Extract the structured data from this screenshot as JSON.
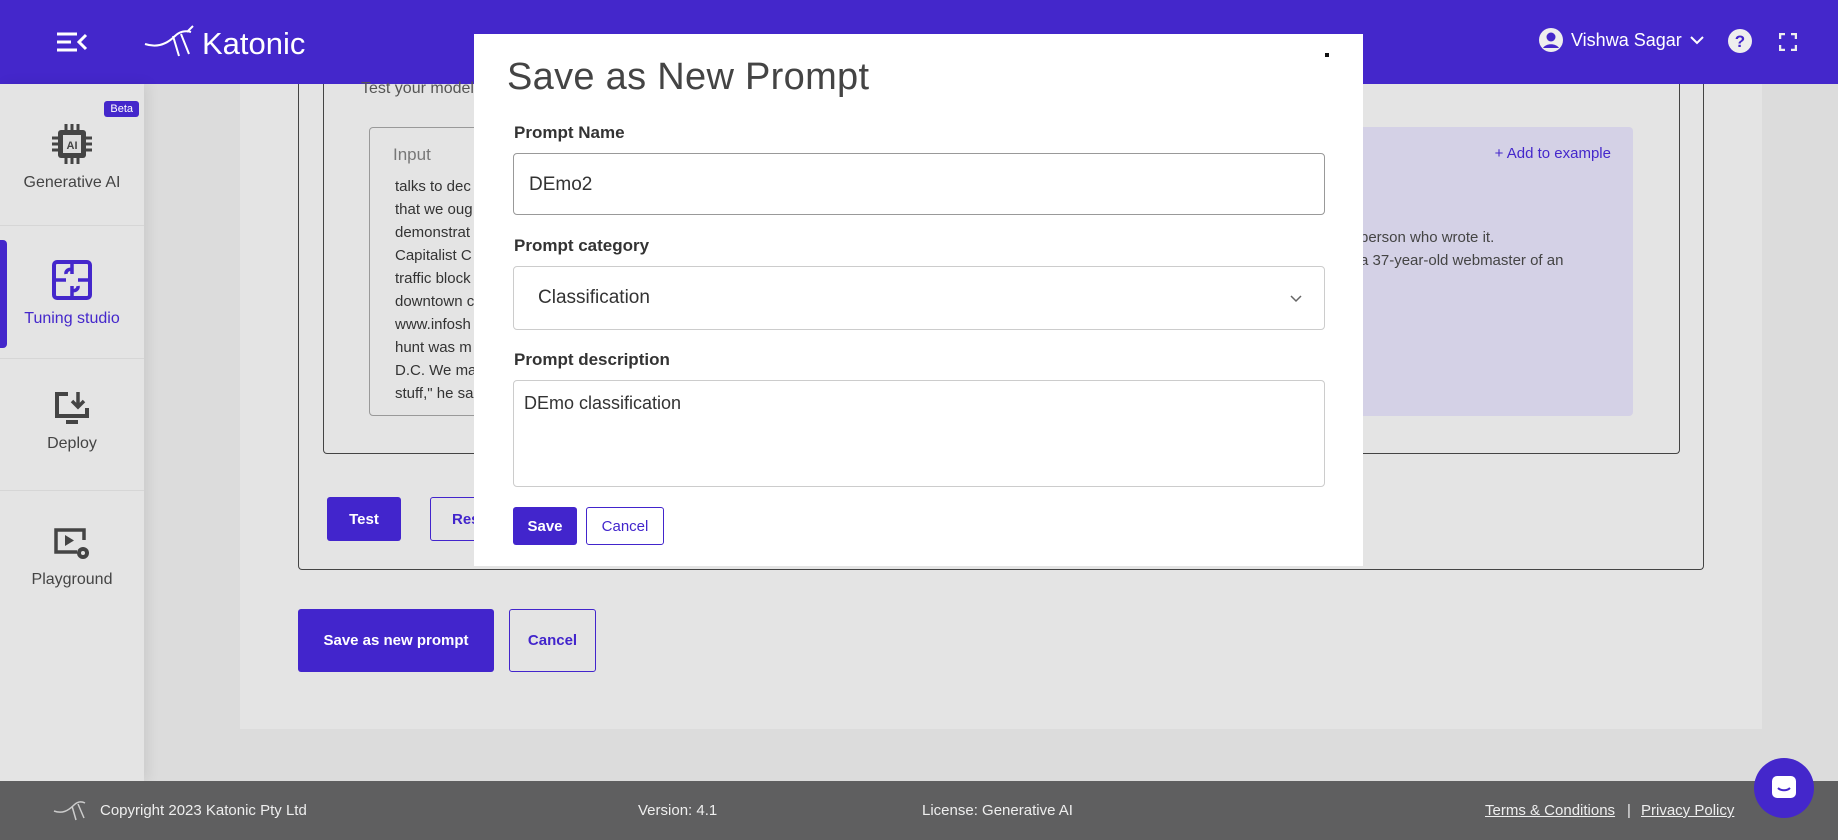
{
  "header": {
    "brand": "Katonic",
    "user_name": "Vishwa Sagar",
    "colors": {
      "brand": "#4427cb"
    }
  },
  "sidebar": {
    "items": [
      {
        "label": "Generative AI",
        "badge": "Beta",
        "icon": "ai-chip-icon"
      },
      {
        "label": "Tuning studio",
        "icon": "puzzle-icon",
        "active": true
      },
      {
        "label": "Deploy",
        "icon": "deploy-icon"
      },
      {
        "label": "Playground",
        "icon": "playground-icon"
      }
    ]
  },
  "main": {
    "subtitle": "Test your model",
    "input_label": "Input",
    "input_lines": [
      "talks to dec",
      "that we oug",
      "demonstrat",
      "Capitalist C",
      "traffic block",
      "downtown c",
      "www.infosh",
      "hunt was m",
      "D.C. We ma",
      "stuff,\" he sa"
    ],
    "add_example": "+ Add to example",
    "output_lines": [
      "person who wrote it.",
      "a 37-year-old webmaster of an"
    ],
    "test_label": "Test",
    "reset_label": "Res",
    "save_new_label": "Save as new prompt",
    "cancel_label": "Cancel"
  },
  "modal": {
    "title": "Save as New Prompt",
    "name_label": "Prompt Name",
    "name_value": "DEmo2",
    "category_label": "Prompt category",
    "category_value": "Classification",
    "description_label": "Prompt description",
    "description_value": "DEmo classification",
    "save_label": "Save",
    "cancel_label": "Cancel"
  },
  "footer": {
    "copyright": "Copyright 2023 Katonic Pty Ltd",
    "version": "Version: 4.1",
    "license": "License: Generative AI",
    "terms": "Terms & Conditions",
    "separator": "|",
    "privacy": "Privacy Policy"
  }
}
